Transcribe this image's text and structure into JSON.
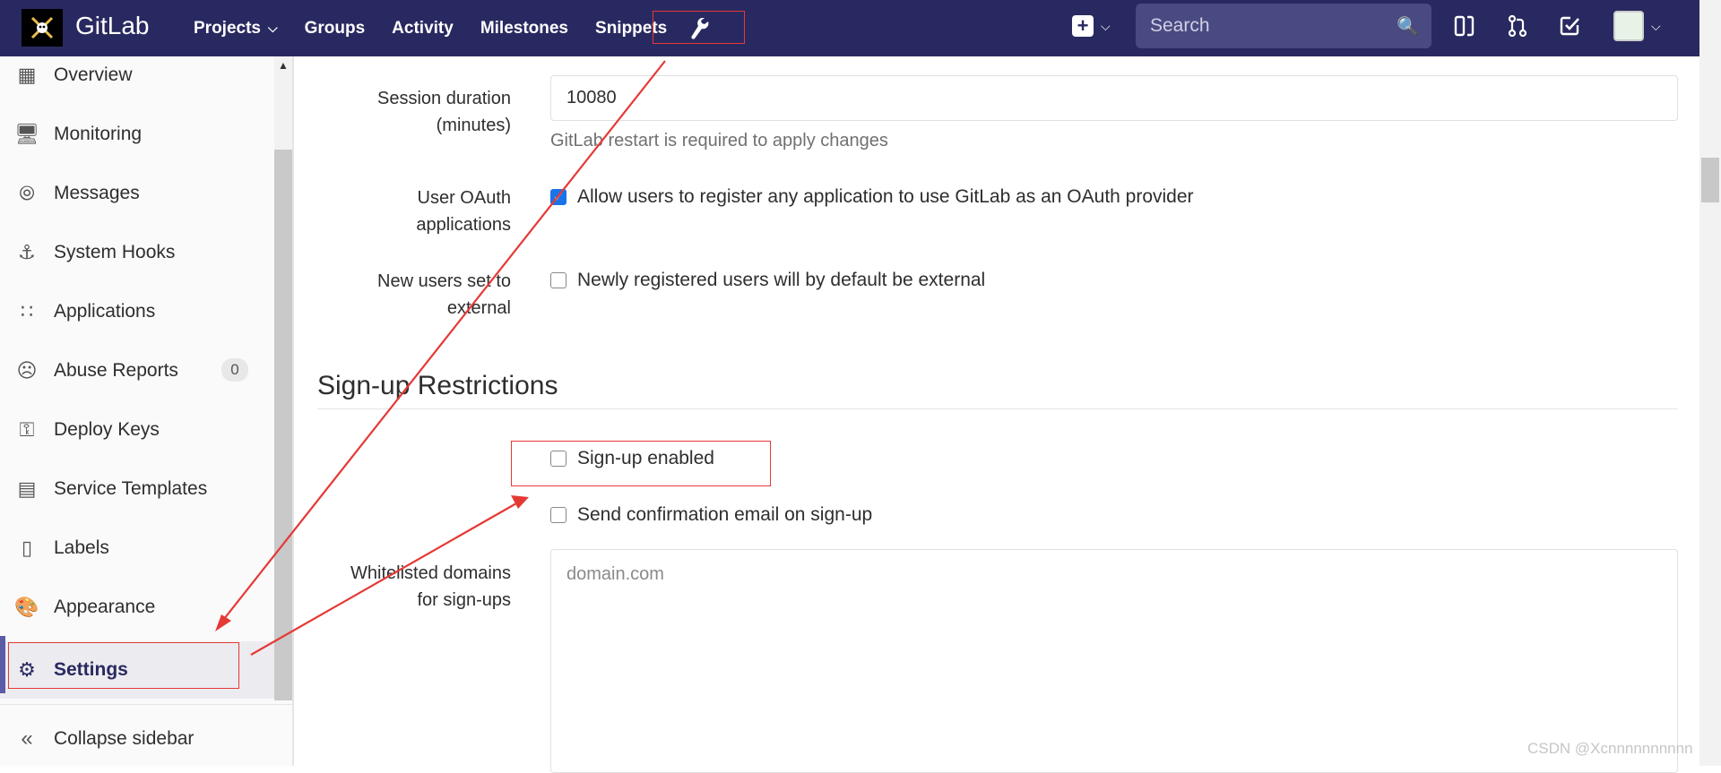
{
  "navbar": {
    "brand": "GitLab",
    "links": [
      {
        "label": "Projects",
        "has_caret": true
      },
      {
        "label": "Groups"
      },
      {
        "label": "Activity"
      },
      {
        "label": "Milestones"
      },
      {
        "label": "Snippets"
      }
    ],
    "admin_icon": "wrench-icon",
    "search_placeholder": "Search",
    "icons": [
      "plus-square-icon",
      "issues-icon",
      "merge-request-icon",
      "todo-check-icon",
      "avatar"
    ]
  },
  "sidebar": {
    "items": [
      {
        "label": "Overview",
        "icon": "grid-icon"
      },
      {
        "label": "Monitoring",
        "icon": "monitor-icon"
      },
      {
        "label": "Messages",
        "icon": "broadcast-icon"
      },
      {
        "label": "System Hooks",
        "icon": "anchor-icon"
      },
      {
        "label": "Applications",
        "icon": "apps-grid-icon"
      },
      {
        "label": "Abuse Reports",
        "icon": "frown-icon",
        "badge": "0"
      },
      {
        "label": "Deploy Keys",
        "icon": "key-icon"
      },
      {
        "label": "Service Templates",
        "icon": "template-icon"
      },
      {
        "label": "Labels",
        "icon": "label-icon"
      },
      {
        "label": "Appearance",
        "icon": "palette-icon"
      },
      {
        "label": "Settings",
        "icon": "gear-icon",
        "active": true
      }
    ],
    "collapse_label": "Collapse sidebar"
  },
  "form": {
    "session_duration": {
      "label_line1": "Session duration",
      "label_line2": "(minutes)",
      "value": "10080",
      "help": "GitLab restart is required to apply changes"
    },
    "user_oauth": {
      "label_line1": "User OAuth",
      "label_line2": "applications",
      "text": "Allow users to register any application to use GitLab as an OAuth provider",
      "checked": true
    },
    "new_users_external": {
      "label_line1": "New users set to",
      "label_line2": "external",
      "text": "Newly registered users will by default be external",
      "checked": false
    }
  },
  "signup": {
    "title": "Sign-up Restrictions",
    "signup_enabled": {
      "text": "Sign-up enabled",
      "checked": false
    },
    "send_confirmation": {
      "text": "Send confirmation email on sign-up",
      "checked": false
    },
    "whitelist": {
      "label_line1": "Whitelisted domains",
      "label_line2": "for sign-ups",
      "placeholder": "domain.com"
    }
  },
  "annotation_color": "#e53935",
  "accent_color": "#292961",
  "watermark": "CSDN @Xcnnnnnnnnnn"
}
